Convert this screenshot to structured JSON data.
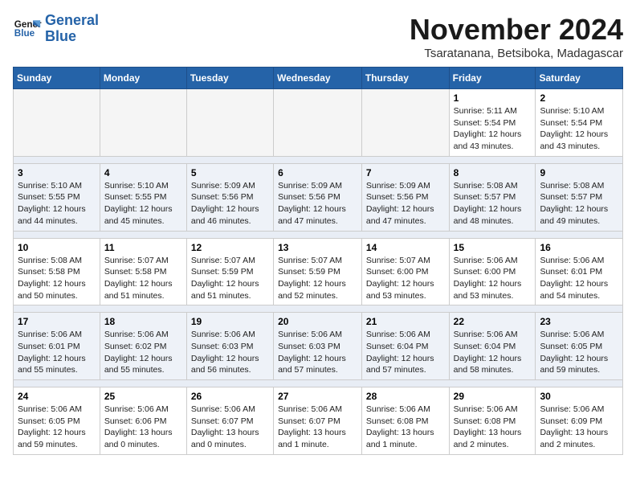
{
  "logo": {
    "line1": "General",
    "line2": "Blue"
  },
  "title": "November 2024",
  "location": "Tsaratanana, Betsiboka, Madagascar",
  "weekdays": [
    "Sunday",
    "Monday",
    "Tuesday",
    "Wednesday",
    "Thursday",
    "Friday",
    "Saturday"
  ],
  "weeks": [
    [
      {
        "day": "",
        "info": ""
      },
      {
        "day": "",
        "info": ""
      },
      {
        "day": "",
        "info": ""
      },
      {
        "day": "",
        "info": ""
      },
      {
        "day": "",
        "info": ""
      },
      {
        "day": "1",
        "info": "Sunrise: 5:11 AM\nSunset: 5:54 PM\nDaylight: 12 hours\nand 43 minutes."
      },
      {
        "day": "2",
        "info": "Sunrise: 5:10 AM\nSunset: 5:54 PM\nDaylight: 12 hours\nand 43 minutes."
      }
    ],
    [
      {
        "day": "3",
        "info": "Sunrise: 5:10 AM\nSunset: 5:55 PM\nDaylight: 12 hours\nand 44 minutes."
      },
      {
        "day": "4",
        "info": "Sunrise: 5:10 AM\nSunset: 5:55 PM\nDaylight: 12 hours\nand 45 minutes."
      },
      {
        "day": "5",
        "info": "Sunrise: 5:09 AM\nSunset: 5:56 PM\nDaylight: 12 hours\nand 46 minutes."
      },
      {
        "day": "6",
        "info": "Sunrise: 5:09 AM\nSunset: 5:56 PM\nDaylight: 12 hours\nand 47 minutes."
      },
      {
        "day": "7",
        "info": "Sunrise: 5:09 AM\nSunset: 5:56 PM\nDaylight: 12 hours\nand 47 minutes."
      },
      {
        "day": "8",
        "info": "Sunrise: 5:08 AM\nSunset: 5:57 PM\nDaylight: 12 hours\nand 48 minutes."
      },
      {
        "day": "9",
        "info": "Sunrise: 5:08 AM\nSunset: 5:57 PM\nDaylight: 12 hours\nand 49 minutes."
      }
    ],
    [
      {
        "day": "10",
        "info": "Sunrise: 5:08 AM\nSunset: 5:58 PM\nDaylight: 12 hours\nand 50 minutes."
      },
      {
        "day": "11",
        "info": "Sunrise: 5:07 AM\nSunset: 5:58 PM\nDaylight: 12 hours\nand 51 minutes."
      },
      {
        "day": "12",
        "info": "Sunrise: 5:07 AM\nSunset: 5:59 PM\nDaylight: 12 hours\nand 51 minutes."
      },
      {
        "day": "13",
        "info": "Sunrise: 5:07 AM\nSunset: 5:59 PM\nDaylight: 12 hours\nand 52 minutes."
      },
      {
        "day": "14",
        "info": "Sunrise: 5:07 AM\nSunset: 6:00 PM\nDaylight: 12 hours\nand 53 minutes."
      },
      {
        "day": "15",
        "info": "Sunrise: 5:06 AM\nSunset: 6:00 PM\nDaylight: 12 hours\nand 53 minutes."
      },
      {
        "day": "16",
        "info": "Sunrise: 5:06 AM\nSunset: 6:01 PM\nDaylight: 12 hours\nand 54 minutes."
      }
    ],
    [
      {
        "day": "17",
        "info": "Sunrise: 5:06 AM\nSunset: 6:01 PM\nDaylight: 12 hours\nand 55 minutes."
      },
      {
        "day": "18",
        "info": "Sunrise: 5:06 AM\nSunset: 6:02 PM\nDaylight: 12 hours\nand 55 minutes."
      },
      {
        "day": "19",
        "info": "Sunrise: 5:06 AM\nSunset: 6:03 PM\nDaylight: 12 hours\nand 56 minutes."
      },
      {
        "day": "20",
        "info": "Sunrise: 5:06 AM\nSunset: 6:03 PM\nDaylight: 12 hours\nand 57 minutes."
      },
      {
        "day": "21",
        "info": "Sunrise: 5:06 AM\nSunset: 6:04 PM\nDaylight: 12 hours\nand 57 minutes."
      },
      {
        "day": "22",
        "info": "Sunrise: 5:06 AM\nSunset: 6:04 PM\nDaylight: 12 hours\nand 58 minutes."
      },
      {
        "day": "23",
        "info": "Sunrise: 5:06 AM\nSunset: 6:05 PM\nDaylight: 12 hours\nand 59 minutes."
      }
    ],
    [
      {
        "day": "24",
        "info": "Sunrise: 5:06 AM\nSunset: 6:05 PM\nDaylight: 12 hours\nand 59 minutes."
      },
      {
        "day": "25",
        "info": "Sunrise: 5:06 AM\nSunset: 6:06 PM\nDaylight: 13 hours\nand 0 minutes."
      },
      {
        "day": "26",
        "info": "Sunrise: 5:06 AM\nSunset: 6:07 PM\nDaylight: 13 hours\nand 0 minutes."
      },
      {
        "day": "27",
        "info": "Sunrise: 5:06 AM\nSunset: 6:07 PM\nDaylight: 13 hours\nand 1 minute."
      },
      {
        "day": "28",
        "info": "Sunrise: 5:06 AM\nSunset: 6:08 PM\nDaylight: 13 hours\nand 1 minute."
      },
      {
        "day": "29",
        "info": "Sunrise: 5:06 AM\nSunset: 6:08 PM\nDaylight: 13 hours\nand 2 minutes."
      },
      {
        "day": "30",
        "info": "Sunrise: 5:06 AM\nSunset: 6:09 PM\nDaylight: 13 hours\nand 2 minutes."
      }
    ]
  ]
}
